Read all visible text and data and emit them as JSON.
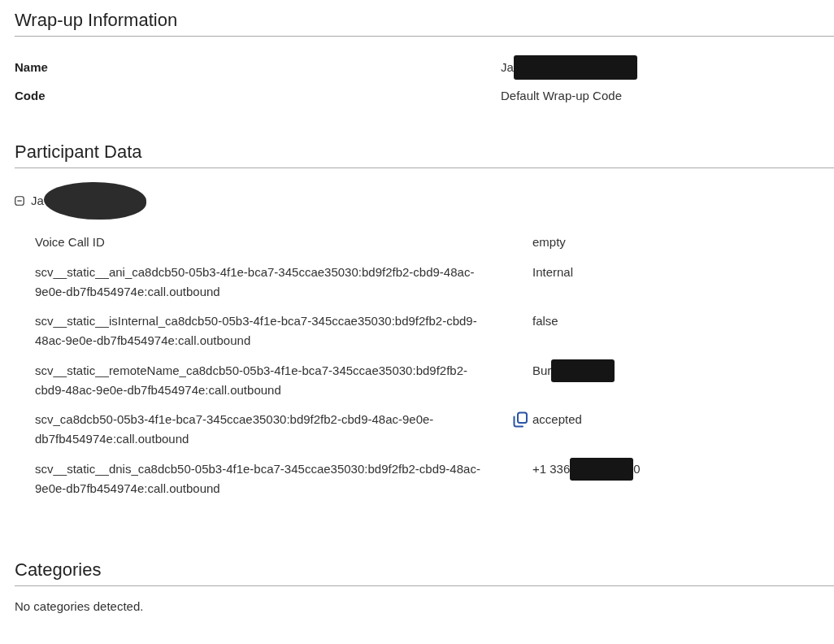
{
  "sections": [
    {
      "kind": "fields",
      "title": "Wrap-up Information",
      "fields": [
        {
          "label": "Name",
          "value": [
            {
              "kind": "text",
              "text": "Ja"
            },
            {
              "kind": "redaction"
            }
          ]
        },
        {
          "label": "Code",
          "value": [
            {
              "kind": "text",
              "text": "Default Wrap-up Code"
            }
          ]
        }
      ]
    },
    {
      "kind": "participants",
      "title": "Participant Data",
      "participants": [
        {
          "expanded": true,
          "name": [
            {
              "kind": "text",
              "text": "Ja"
            },
            {
              "kind": "redaction"
            }
          ],
          "attributes": [
            {
              "key": "Voice Call ID",
              "value": [
                {
                  "kind": "text",
                  "text": "empty"
                }
              ],
              "copy_icon": false
            },
            {
              "key": "scv__static__ani_ca8dcb50-05b3-4f1e-bca7-345ccae35030:bd9f2fb2-cbd9-48ac-9e0e-db7fb454974e:call.outbound",
              "value": [
                {
                  "kind": "text",
                  "text": "Internal"
                }
              ],
              "copy_icon": false
            },
            {
              "key": "scv__static__isInternal_ca8dcb50-05b3-4f1e-bca7-345ccae35030:bd9f2fb2-cbd9-48ac-9e0e-db7fb454974e:call.outbound",
              "value": [
                {
                  "kind": "text",
                  "text": "false"
                }
              ],
              "copy_icon": false
            },
            {
              "key": "scv__static__remoteName_ca8dcb50-05b3-4f1e-bca7-345ccae35030:bd9f2fb2-cbd9-48ac-9e0e-db7fb454974e:call.outbound",
              "value": [
                {
                  "kind": "text",
                  "text": "Bur"
                },
                {
                  "kind": "redaction"
                }
              ],
              "copy_icon": false
            },
            {
              "key": "scv_ca8dcb50-05b3-4f1e-bca7-345ccae35030:bd9f2fb2-cbd9-48ac-9e0e-db7fb454974e:call.outbound",
              "value": [
                {
                  "kind": "text",
                  "text": "accepted"
                }
              ],
              "copy_icon": true
            },
            {
              "key": "scv__static__dnis_ca8dcb50-05b3-4f1e-bca7-345ccae35030:bd9f2fb2-cbd9-48ac-9e0e-db7fb454974e:call.outbound",
              "value": [
                {
                  "kind": "text",
                  "text": "+1 336"
                },
                {
                  "kind": "redaction"
                },
                {
                  "kind": "text",
                  "text": "0"
                }
              ],
              "copy_icon": false
            }
          ]
        }
      ]
    },
    {
      "kind": "message",
      "title": "Categories",
      "message": "No categories detected."
    }
  ]
}
